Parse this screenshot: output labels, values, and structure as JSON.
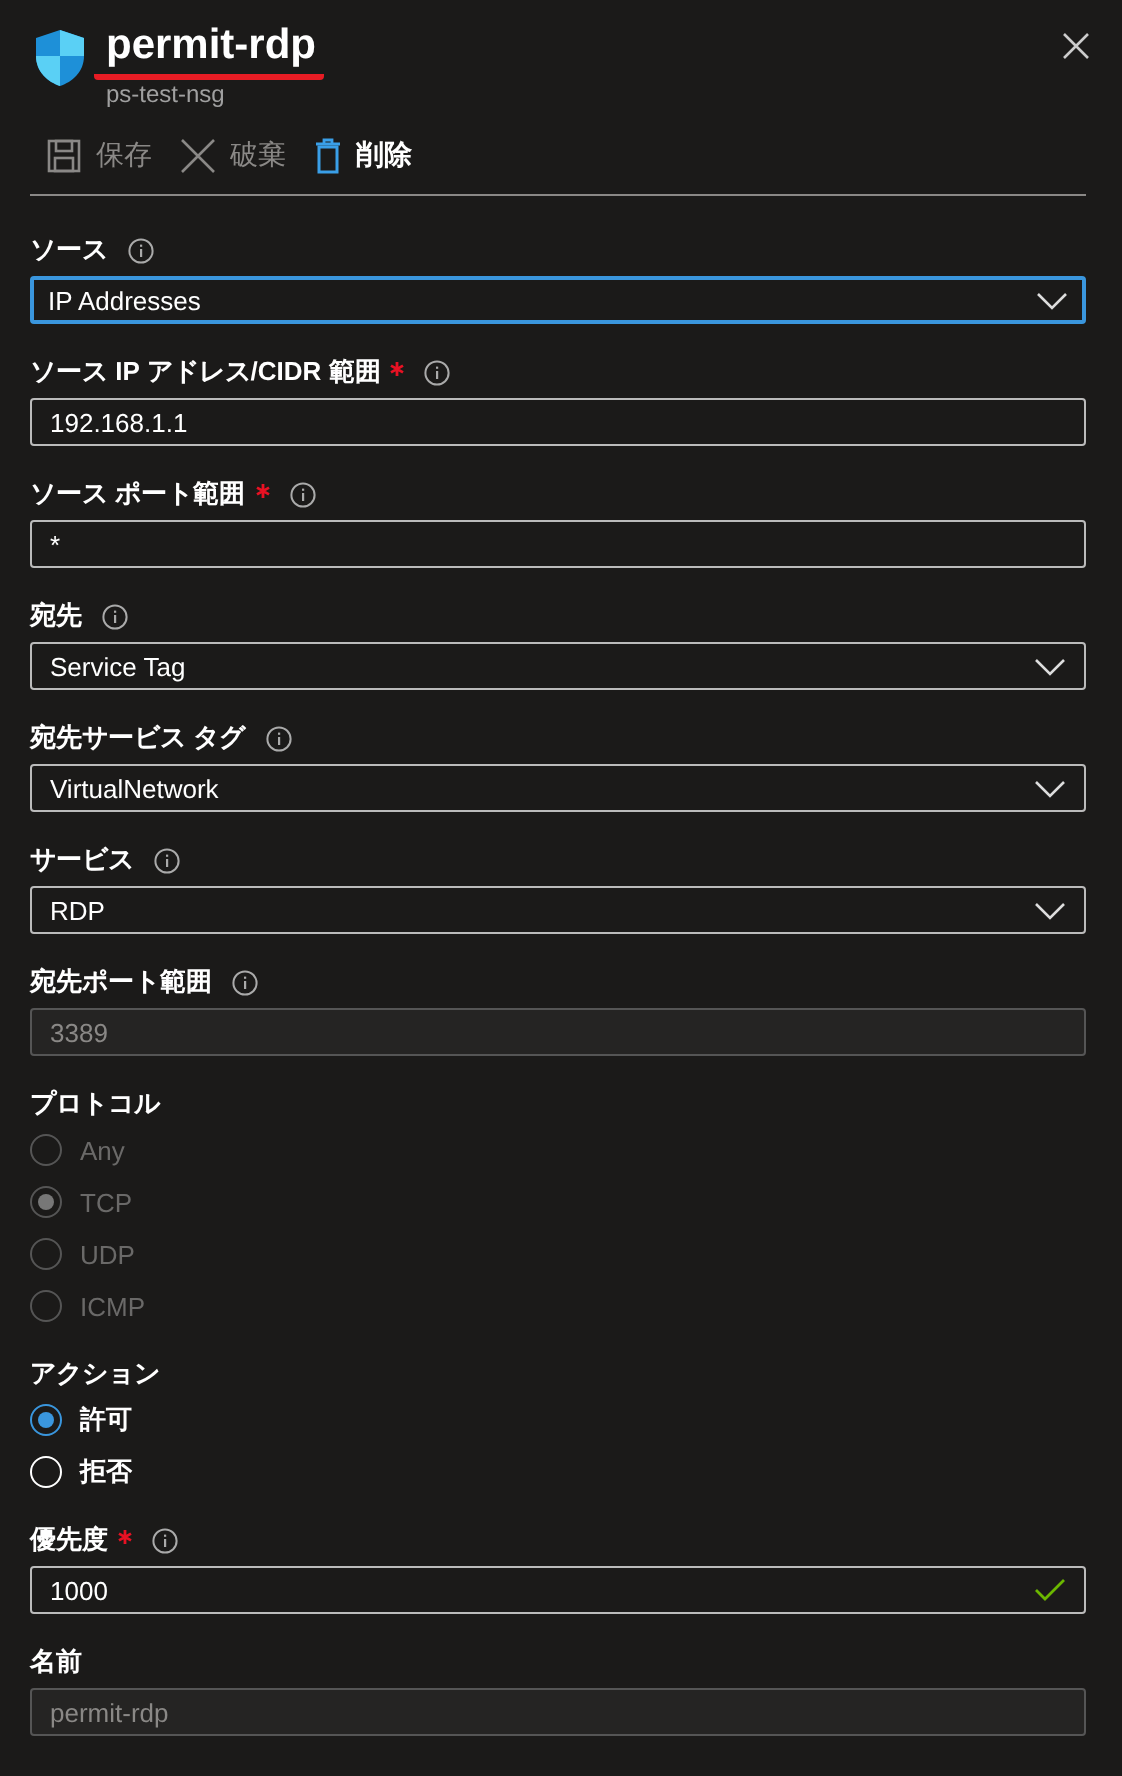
{
  "header": {
    "title": "permit-rdp",
    "subtitle": "ps-test-nsg",
    "title_underlined": true
  },
  "toolbar": [
    {
      "kind": "save",
      "label": "保存",
      "disabled": true
    },
    {
      "kind": "discard",
      "label": "破棄",
      "disabled": true
    },
    {
      "kind": "delete",
      "label": "削除",
      "disabled": false
    }
  ],
  "fields": [
    {
      "kind": "select",
      "label": "ソース",
      "required": false,
      "info": true,
      "value": "IP Addresses",
      "focused": true,
      "disabled": false
    },
    {
      "kind": "input",
      "label": "ソース IP アドレス/CIDR 範囲",
      "required": true,
      "info": true,
      "value": "192.168.1.1",
      "focused": false,
      "disabled": false
    },
    {
      "kind": "input",
      "label": "ソース ポート範囲",
      "required": true,
      "info": true,
      "value": "*",
      "focused": false,
      "disabled": false
    },
    {
      "kind": "select",
      "label": "宛先",
      "required": false,
      "info": true,
      "value": "Service Tag",
      "focused": false,
      "disabled": false
    },
    {
      "kind": "select",
      "label": "宛先サービス タグ",
      "required": false,
      "info": true,
      "value": "VirtualNetwork",
      "focused": false,
      "disabled": false
    },
    {
      "kind": "select",
      "label": "サービス",
      "required": false,
      "info": true,
      "value": "RDP",
      "focused": false,
      "disabled": false
    },
    {
      "kind": "input",
      "label": "宛先ポート範囲",
      "required": false,
      "info": true,
      "value": "3389",
      "focused": false,
      "disabled": true
    },
    {
      "kind": "radio",
      "label": "プロトコル",
      "required": false,
      "info": false,
      "options": [
        {
          "label": "Any",
          "selected": false,
          "disabled": true
        },
        {
          "label": "TCP",
          "selected": true,
          "disabled": true
        },
        {
          "label": "UDP",
          "selected": false,
          "disabled": true
        },
        {
          "label": "ICMP",
          "selected": false,
          "disabled": true
        }
      ]
    },
    {
      "kind": "radio",
      "label": "アクション",
      "required": false,
      "info": false,
      "options": [
        {
          "label": "許可",
          "selected": true,
          "disabled": false
        },
        {
          "label": "拒否",
          "selected": false,
          "disabled": false
        }
      ]
    },
    {
      "kind": "input",
      "label": "優先度",
      "required": true,
      "info": true,
      "value": "1000",
      "focused": false,
      "disabled": false,
      "valid": true
    },
    {
      "kind": "input",
      "label": "名前",
      "required": false,
      "info": false,
      "value": "permit-rdp",
      "focused": false,
      "disabled": true
    }
  ]
}
